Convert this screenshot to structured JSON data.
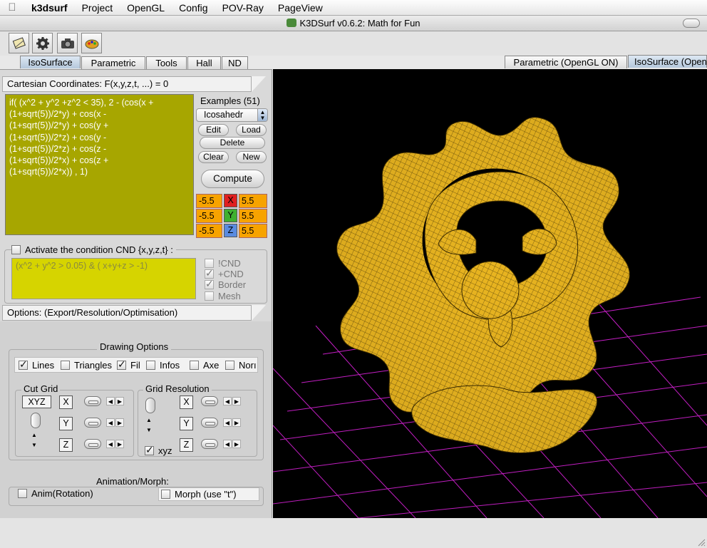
{
  "menubar": {
    "app": "k3dsurf",
    "items": [
      "Project",
      "OpenGL",
      "Config",
      "POV-Ray",
      "PageView"
    ]
  },
  "window": {
    "title": "K3DSurf v0.6.2: Math for Fun"
  },
  "left_tabs": [
    "IsoSurface",
    "Parametric",
    "Tools",
    "Hall",
    "ND"
  ],
  "right_tabs": [
    "Parametric (OpenGL ON)",
    "IsoSurface (Open"
  ],
  "cartesian": {
    "header": "Cartesian Coordinates: F(x,y,z,t, ...) = 0",
    "formula_lines": [
      "if( (x^2 + y^2 +z^2 < 35), 2 - (cos(x +",
      "(1+sqrt(5))/2*y) + cos(x -",
      "(1+sqrt(5))/2*y) + cos(y +",
      "(1+sqrt(5))/2*z) + cos(y -",
      "(1+sqrt(5))/2*z) + cos(z -",
      "(1+sqrt(5))/2*x) + cos(z +",
      "(1+sqrt(5))/2*x)) , 1)"
    ],
    "examples_label": "Examples (51)",
    "example_selected": "Icosahedr",
    "edit": "Edit",
    "load": "Load",
    "delete": "Delete",
    "clear": "Clear",
    "new": "New",
    "compute": "Compute",
    "ranges": [
      {
        "axis": "X",
        "min": "-5.5",
        "max": "5.5",
        "color": "#e02020"
      },
      {
        "axis": "Y",
        "min": "-5.5",
        "max": "5.5",
        "color": "#40b030"
      },
      {
        "axis": "Z",
        "min": "-5.5",
        "max": "5.5",
        "color": "#5a8be0"
      }
    ]
  },
  "condition": {
    "label": "Activate the condition CND {x,y,z,t} :",
    "expr": "(x^2 + y^2 > 0.05) & ( x+y+z > -1)",
    "not_cnd": "!CND",
    "plus_cnd": "+CND",
    "border": "Border",
    "mesh": "Mesh"
  },
  "options": {
    "header": "Options: (Export/Resolution/Optimisation)",
    "drawing_title": "Drawing Options",
    "lines": "Lines",
    "triangles": "Triangles",
    "fill": "Fil",
    "infos": "Infos",
    "axe": "Axe",
    "normales": "Norı",
    "cut_grid": "Cut Grid",
    "xyz_btn": "XYZ",
    "grid_res": "Grid Resolution",
    "xyz_chk": "xyz",
    "axes": [
      "X",
      "Y",
      "Z"
    ],
    "anim_title": "Animation/Morph:",
    "anim": "Anim(Rotation)",
    "morph": "Morph (use \"t\")"
  }
}
